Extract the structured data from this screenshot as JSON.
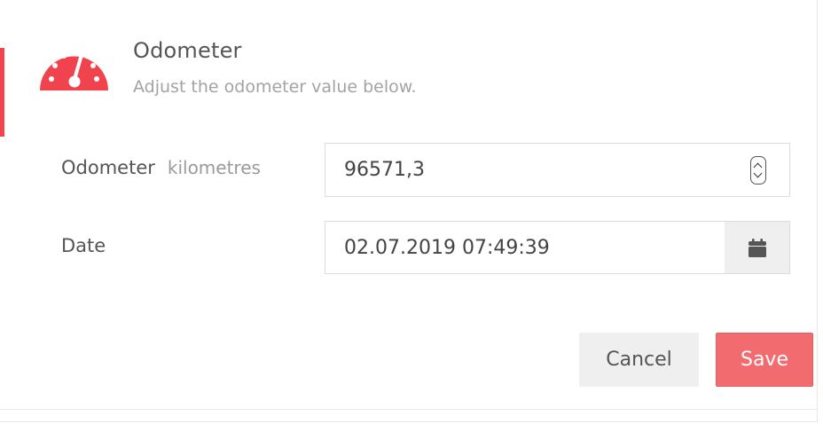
{
  "header": {
    "title": "Odometer",
    "subtitle": "Adjust the odometer value below.",
    "icon": "odometer-gauge-icon",
    "accent_color": "#f0434d"
  },
  "form": {
    "odometer": {
      "label": "Odometer",
      "unit": "kilometres",
      "value": "96571,3"
    },
    "date": {
      "label": "Date",
      "value": "02.07.2019 07:49:39",
      "button_icon": "calendar-icon"
    }
  },
  "actions": {
    "cancel_label": "Cancel",
    "save_label": "Save",
    "save_color": "#f26b6f"
  }
}
